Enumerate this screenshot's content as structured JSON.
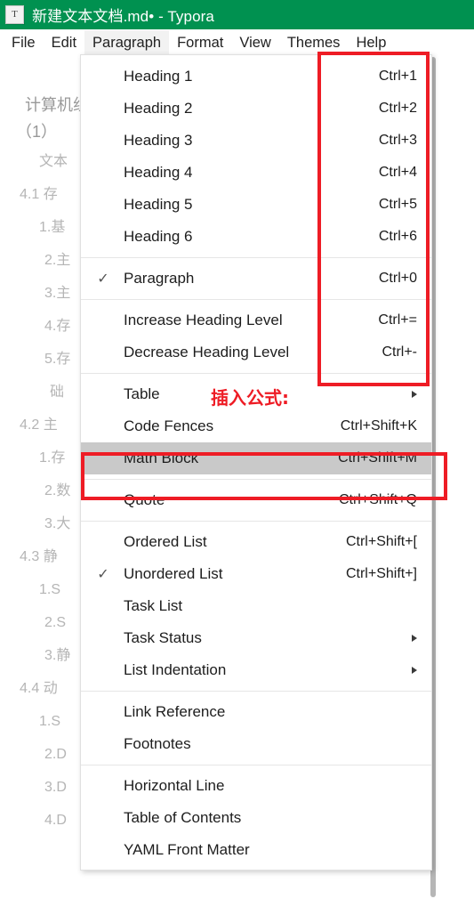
{
  "window": {
    "app_icon_glyph": "T",
    "title": "新建文本文档.md• - Typora",
    "titlebar_color": "#009150"
  },
  "menubar": {
    "items": [
      {
        "label": "File",
        "active": false
      },
      {
        "label": "Edit",
        "active": false
      },
      {
        "label": "Paragraph",
        "active": true
      },
      {
        "label": "Format",
        "active": false
      },
      {
        "label": "View",
        "active": false
      },
      {
        "label": "Themes",
        "active": false
      },
      {
        "label": "Help",
        "active": false
      }
    ]
  },
  "dropdown": {
    "name": "Paragraph",
    "groups": [
      {
        "items": [
          {
            "label": "Heading 1",
            "accel": "Ctrl+1",
            "checked": false,
            "submenu": false,
            "selected": false
          },
          {
            "label": "Heading 2",
            "accel": "Ctrl+2",
            "checked": false,
            "submenu": false,
            "selected": false
          },
          {
            "label": "Heading 3",
            "accel": "Ctrl+3",
            "checked": false,
            "submenu": false,
            "selected": false
          },
          {
            "label": "Heading 4",
            "accel": "Ctrl+4",
            "checked": false,
            "submenu": false,
            "selected": false
          },
          {
            "label": "Heading 5",
            "accel": "Ctrl+5",
            "checked": false,
            "submenu": false,
            "selected": false
          },
          {
            "label": "Heading 6",
            "accel": "Ctrl+6",
            "checked": false,
            "submenu": false,
            "selected": false
          }
        ]
      },
      {
        "items": [
          {
            "label": "Paragraph",
            "accel": "Ctrl+0",
            "checked": true,
            "submenu": false,
            "selected": false
          }
        ]
      },
      {
        "items": [
          {
            "label": "Increase Heading Level",
            "accel": "Ctrl+=",
            "checked": false,
            "submenu": false,
            "selected": false
          },
          {
            "label": "Decrease Heading Level",
            "accel": "Ctrl+-",
            "checked": false,
            "submenu": false,
            "selected": false
          }
        ]
      },
      {
        "items": [
          {
            "label": "Table",
            "accel": "",
            "checked": false,
            "submenu": true,
            "selected": false
          },
          {
            "label": "Code Fences",
            "accel": "Ctrl+Shift+K",
            "checked": false,
            "submenu": false,
            "selected": false
          },
          {
            "label": "Math Block",
            "accel": "Ctrl+Shift+M",
            "checked": false,
            "submenu": false,
            "selected": true
          }
        ]
      },
      {
        "items": [
          {
            "label": "Quote",
            "accel": "Ctrl+Shift+Q",
            "checked": false,
            "submenu": false,
            "selected": false
          }
        ]
      },
      {
        "items": [
          {
            "label": "Ordered List",
            "accel": "Ctrl+Shift+[",
            "checked": false,
            "submenu": false,
            "selected": false
          },
          {
            "label": "Unordered List",
            "accel": "Ctrl+Shift+]",
            "checked": true,
            "submenu": false,
            "selected": false
          },
          {
            "label": "Task List",
            "accel": "",
            "checked": false,
            "submenu": false,
            "selected": false
          },
          {
            "label": "Task Status",
            "accel": "",
            "checked": false,
            "submenu": true,
            "selected": false
          },
          {
            "label": "List Indentation",
            "accel": "",
            "checked": false,
            "submenu": true,
            "selected": false
          }
        ]
      },
      {
        "items": [
          {
            "label": "Link Reference",
            "accel": "",
            "checked": false,
            "submenu": false,
            "selected": false
          },
          {
            "label": "Footnotes",
            "accel": "",
            "checked": false,
            "submenu": false,
            "selected": false
          }
        ]
      },
      {
        "items": [
          {
            "label": "Horizontal Line",
            "accel": "",
            "checked": false,
            "submenu": false,
            "selected": false
          },
          {
            "label": "Table of Contents",
            "accel": "",
            "checked": false,
            "submenu": false,
            "selected": false
          },
          {
            "label": "YAML Front Matter",
            "accel": "",
            "checked": false,
            "submenu": false,
            "selected": false
          }
        ]
      }
    ],
    "checkmark_glyph": "✓"
  },
  "annotations": {
    "color": "#ee1c25",
    "formula_note": "插入公式:",
    "boxes": [
      "shortcut-column-box",
      "math-block-box"
    ]
  },
  "document": {
    "lines": [
      {
        "text": "计算机组",
        "indent": 28,
        "heading": true
      },
      {
        "text": "（1）",
        "indent": 18,
        "heading": true
      },
      {
        "text": "文本",
        "indent": 44,
        "heading": false
      },
      {
        "text": "4.1 存",
        "indent": 22,
        "heading": false
      },
      {
        "text": "1.基",
        "indent": 44,
        "heading": false
      },
      {
        "text": "2.主",
        "indent": 50,
        "heading": false
      },
      {
        "text": "3.主",
        "indent": 50,
        "heading": false
      },
      {
        "text": "4.存",
        "indent": 50,
        "heading": false
      },
      {
        "text": "5.存",
        "indent": 50,
        "heading": false
      },
      {
        "text": "础",
        "indent": 56,
        "heading": false
      },
      {
        "text": "4.2 主",
        "indent": 22,
        "heading": false
      },
      {
        "text": "1.存",
        "indent": 44,
        "heading": false
      },
      {
        "text": "2.数",
        "indent": 50,
        "heading": false
      },
      {
        "text": "3.大",
        "indent": 50,
        "heading": false
      },
      {
        "text": "4.3 静",
        "indent": 22,
        "heading": false
      },
      {
        "text": "1.S",
        "indent": 44,
        "heading": false
      },
      {
        "text": "2.S",
        "indent": 50,
        "heading": false
      },
      {
        "text": "3.静",
        "indent": 50,
        "heading": false
      },
      {
        "text": "4.4 动",
        "indent": 22,
        "heading": false
      },
      {
        "text": "1.S",
        "indent": 44,
        "heading": false
      },
      {
        "text": "2.D",
        "indent": 50,
        "heading": false
      },
      {
        "text": "3.D",
        "indent": 50,
        "heading": false
      },
      {
        "text": "4.D",
        "indent": 50,
        "heading": false
      }
    ]
  }
}
